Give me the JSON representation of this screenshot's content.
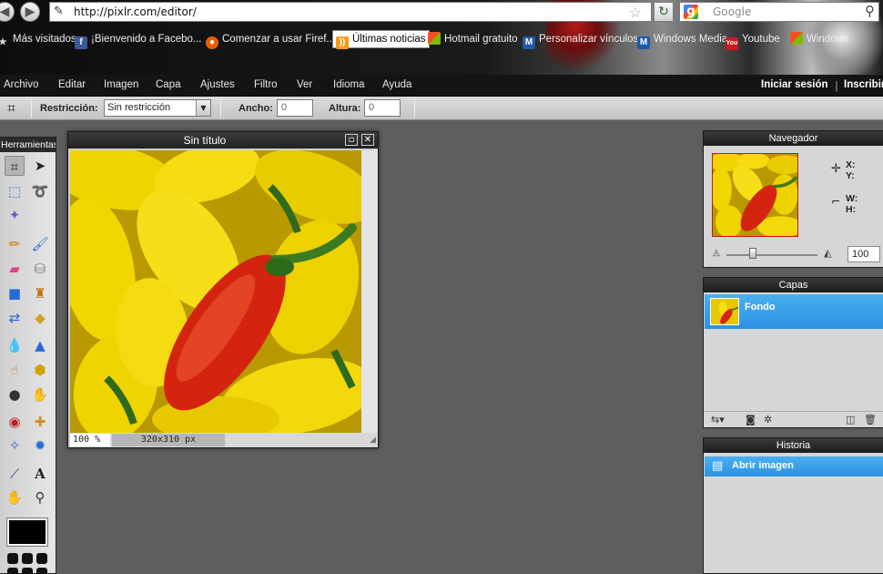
{
  "browser": {
    "url": "http://pixlr.com/editor/",
    "search_placeholder": "Google",
    "bookmarks": [
      {
        "label": "Más visitados",
        "icon": "star-folder-icon"
      },
      {
        "label": "¡Bienvenido a Facebo...",
        "icon": "facebook-icon"
      },
      {
        "label": "Comenzar a usar Firef...",
        "icon": "firefox-icon"
      },
      {
        "label": "Últimas noticias",
        "icon": "rss-icon"
      },
      {
        "label": "Hotmail gratuito",
        "icon": "windows-icon"
      },
      {
        "label": "Personalizar vínculos",
        "icon": "msn-icon"
      },
      {
        "label": "Windows Media",
        "icon": "msn-icon"
      },
      {
        "label": "Youtube",
        "icon": "youtube-icon"
      },
      {
        "label": "Windows",
        "icon": "windows-icon"
      }
    ]
  },
  "menubar": {
    "items": [
      "Archivo",
      "Editar",
      "Imagen",
      "Capa",
      "Ajustes",
      "Filtro",
      "Ver",
      "Idioma",
      "Ayuda"
    ],
    "login": "Iniciar sesión",
    "separator": "|",
    "signup": "Inscribir"
  },
  "options": {
    "restriction_label": "Restricción:",
    "restriction_value": "Sin restricción",
    "width_label": "Ancho:",
    "width_value": "0",
    "height_label": "Altura:",
    "height_value": "0"
  },
  "tools": {
    "title": "Herramientas",
    "primary_color": "#000000"
  },
  "image_window": {
    "title": "Sin título",
    "zoom": "100 %",
    "size": "320x310 px"
  },
  "navigator": {
    "title": "Navegador",
    "x_label": "X:",
    "y_label": "Y:",
    "w_label": "W:",
    "h_label": "H:",
    "zoom": "100"
  },
  "layers": {
    "title": "Capas",
    "items": [
      {
        "name": "Fondo"
      }
    ]
  },
  "history": {
    "title": "Historia",
    "items": [
      {
        "label": "Abrir imagen"
      }
    ]
  },
  "colors": {
    "accent": "#2a93e2",
    "panel_title": "#222222",
    "workspace": "#5e5e5e"
  }
}
